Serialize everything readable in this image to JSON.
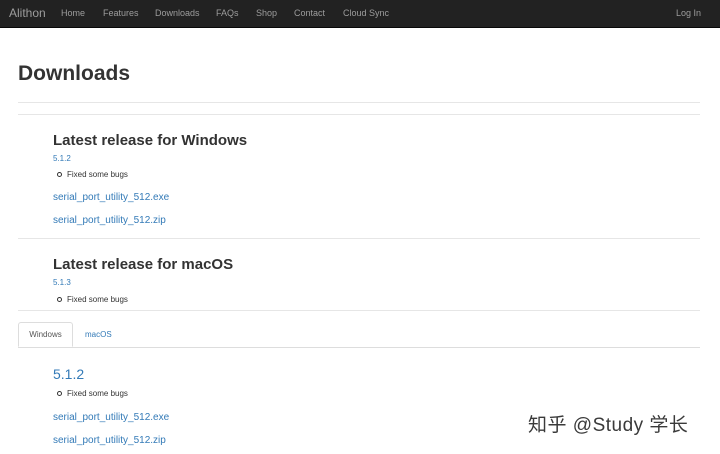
{
  "navbar": {
    "brand": "Alithon",
    "items": [
      "Home",
      "Features",
      "Downloads",
      "FAQs",
      "Shop",
      "Contact",
      "Cloud Sync"
    ],
    "login": "Log In"
  },
  "page": {
    "title": "Downloads"
  },
  "windows_release": {
    "heading": "Latest release for Windows",
    "version": "5.1.2",
    "note": "Fixed some bugs",
    "files": [
      "serial_port_utility_512.exe",
      "serial_port_utility_512.zip"
    ]
  },
  "macos_release": {
    "heading": "Latest release for macOS",
    "version": "5.1.3",
    "note": "Fixed some bugs"
  },
  "tabs": {
    "items": [
      "Windows",
      "macOS"
    ],
    "active": "Windows",
    "panel": {
      "version": "5.1.2",
      "note": "Fixed some bugs",
      "files": [
        "serial_port_utility_512.exe",
        "serial_port_utility_512.zip"
      ]
    }
  },
  "watermark": "知乎 @Study 学长",
  "colors": {
    "navbar": "#222222",
    "link": "#337ab7",
    "text": "#333333"
  }
}
